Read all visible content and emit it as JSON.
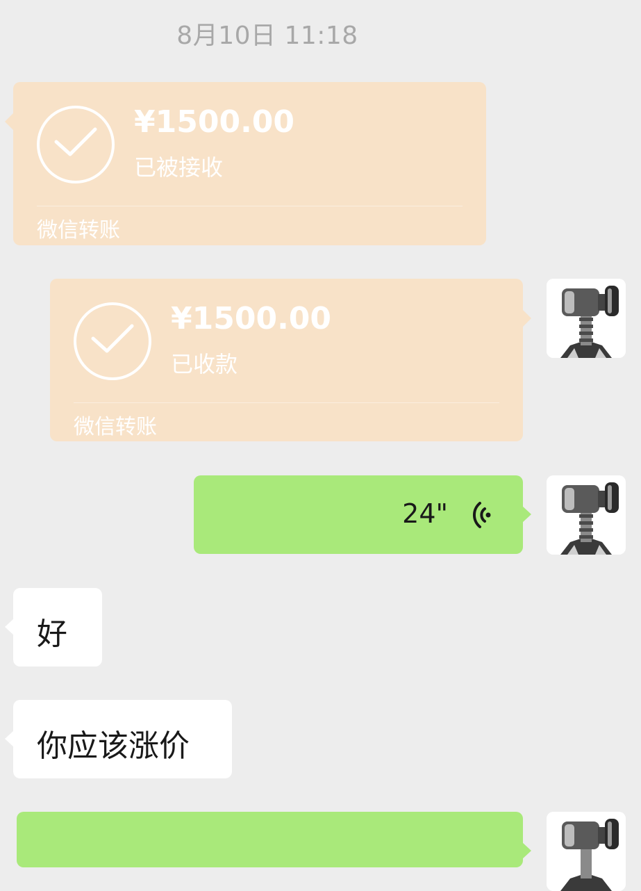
{
  "chat": {
    "timestamp": "8月10日 11:18",
    "transfer_received": {
      "amount": "¥1500.00",
      "status": "已被接收",
      "brand": "微信转账"
    },
    "transfer_collected": {
      "amount": "¥1500.00",
      "status": "已收款",
      "brand": "微信转账"
    },
    "voice_message": {
      "duration": "24\"",
      "icon": "voice-wave-icon"
    },
    "messages": [
      {
        "text": "好"
      },
      {
        "text": "你应该涨价"
      }
    ]
  },
  "colors": {
    "background": "#ededed",
    "transfer_card": "#f8e2c8",
    "outgoing_bubble": "#a9e97a",
    "incoming_bubble": "#ffffff",
    "timestamp_text": "#a8a8a8"
  },
  "avatar": {
    "icon": "gavel-icon"
  }
}
